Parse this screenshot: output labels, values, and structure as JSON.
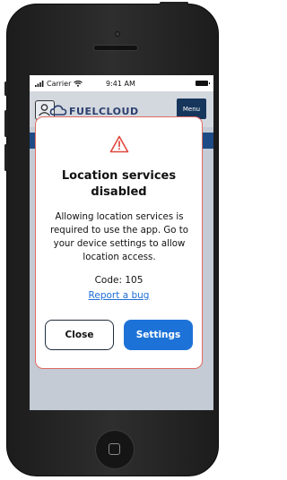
{
  "status_bar": {
    "carrier": "Carrier",
    "time": "9:41 AM"
  },
  "app_bar": {
    "logo_text": "FUELCLOUD",
    "menu_label": "Menu"
  },
  "dialog": {
    "title": "Location services disabled",
    "message": "Allowing location services is required to use the app. Go to your device settings to allow location access.",
    "code": "Code: 105",
    "report_link": "Report a bug",
    "close_label": "Close",
    "settings_label": "Settings"
  },
  "colors": {
    "primary_blue": "#1d72d8",
    "navy": "#16365c",
    "warning_red": "#e0483d",
    "dialog_border": "#e06a62"
  },
  "icons": [
    "signal-icon",
    "wifi-icon",
    "battery-icon",
    "profile-icon",
    "cloud-logo-icon",
    "warning-icon",
    "home-button-icon"
  ]
}
